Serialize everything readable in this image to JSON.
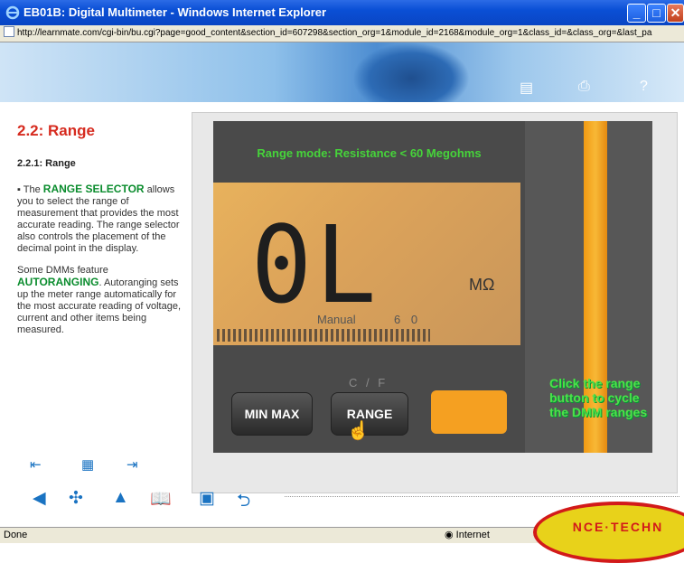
{
  "window": {
    "title": "EB01B: Digital Multimeter - Windows Internet Explorer"
  },
  "address": {
    "url": "http://learnmate.com/cgi-bin/bu.cgi?page=good_content&section_id=607298&section_org=1&module_id=2168&module_org=1&class_id=&class_org=&last_pa"
  },
  "lesson": {
    "title": "2.2: Range",
    "subtitle": "2.2.1: Range",
    "p1_pre": "The ",
    "p1_hl": "RANGE SELECTOR",
    "p1_post": " allows you to select the range of measurement that provides the most accurate reading. The range selector also controls the placement of the decimal point in the display.",
    "p2_pre": "Some DMMs feature ",
    "p2_hl": "AUTORANGING",
    "p2_post": ". Autoranging sets up the meter range automatically for the most accurate reading of voltage, current and other items being measured."
  },
  "meter": {
    "mode_label": "Range mode: Resistance < 60 Megohms",
    "reading": "0L",
    "unit": "MΩ",
    "manual_label": "Manual",
    "range_value": "6 0",
    "cf_label": "C / F",
    "minmax_label": "MIN MAX",
    "range_label": "RANGE",
    "hint": "Click the range button to cycle the DMM ranges"
  },
  "status": {
    "left": "Done",
    "zone": "Internet"
  },
  "seal_text": "NCE·TECHN",
  "colors": {
    "titlebar": "#0a4fd5",
    "title_red": "#d62b1f",
    "highlight_green": "#0a8c2d",
    "lcd_amber": "#dca35a",
    "hint_green": "#4ee14a",
    "orange": "#f19a13"
  }
}
